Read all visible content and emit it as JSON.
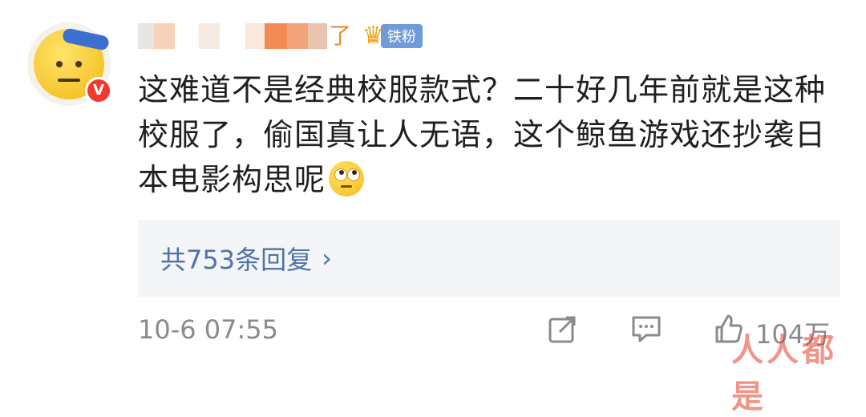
{
  "user": {
    "name_visible_tail": "了",
    "badge_icon": "crown-badge-icon",
    "badge_level": "6",
    "fan_label": "铁粉",
    "verified_mark": "V"
  },
  "comment": {
    "text": "这难道不是经典校服款式？二十好几年前就是这种校服了，偷国真让人无语，这个鲸鱼游戏还抄袭日本电影构思呢",
    "emoji": "rolling-eyes-emoji"
  },
  "replies": {
    "label": "共753条回复",
    "chevron": "›"
  },
  "footer": {
    "timestamp": "10-6 07:55",
    "like_count": "104万",
    "icons": [
      "share-icon",
      "comment-icon",
      "like-icon"
    ]
  },
  "watermark": "人人都是",
  "colors": {
    "link": "#4f72a9",
    "meta": "#8a8a8a",
    "verified": "#f23a2f",
    "fan_badge": "#6f9bd9"
  }
}
